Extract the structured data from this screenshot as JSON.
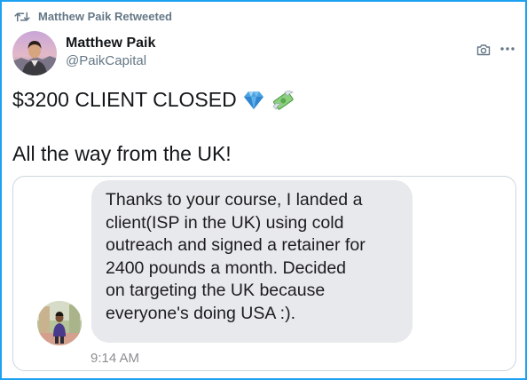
{
  "retweet": {
    "label": "Matthew Paik Retweeted"
  },
  "author": {
    "name": "Matthew Paik",
    "handle": "@PaikCapital"
  },
  "tweet": {
    "line1": "$3200 CLIENT CLOSED",
    "line2": "All the way from the UK!",
    "emojis": [
      "gem-icon",
      "money-with-wings-icon"
    ]
  },
  "message": {
    "lines": [
      "Thanks to your course, I landed a",
      "client(ISP in the UK) using cold",
      "outreach and signed a retainer for",
      "2400 pounds a month. Decided",
      "on targeting the UK because",
      "everyone's doing USA :)."
    ],
    "time": "9:14 AM"
  },
  "colors": {
    "frame_border": "#1da1f2",
    "secondary_text": "#657786",
    "bubble": "#e8e9ec"
  }
}
